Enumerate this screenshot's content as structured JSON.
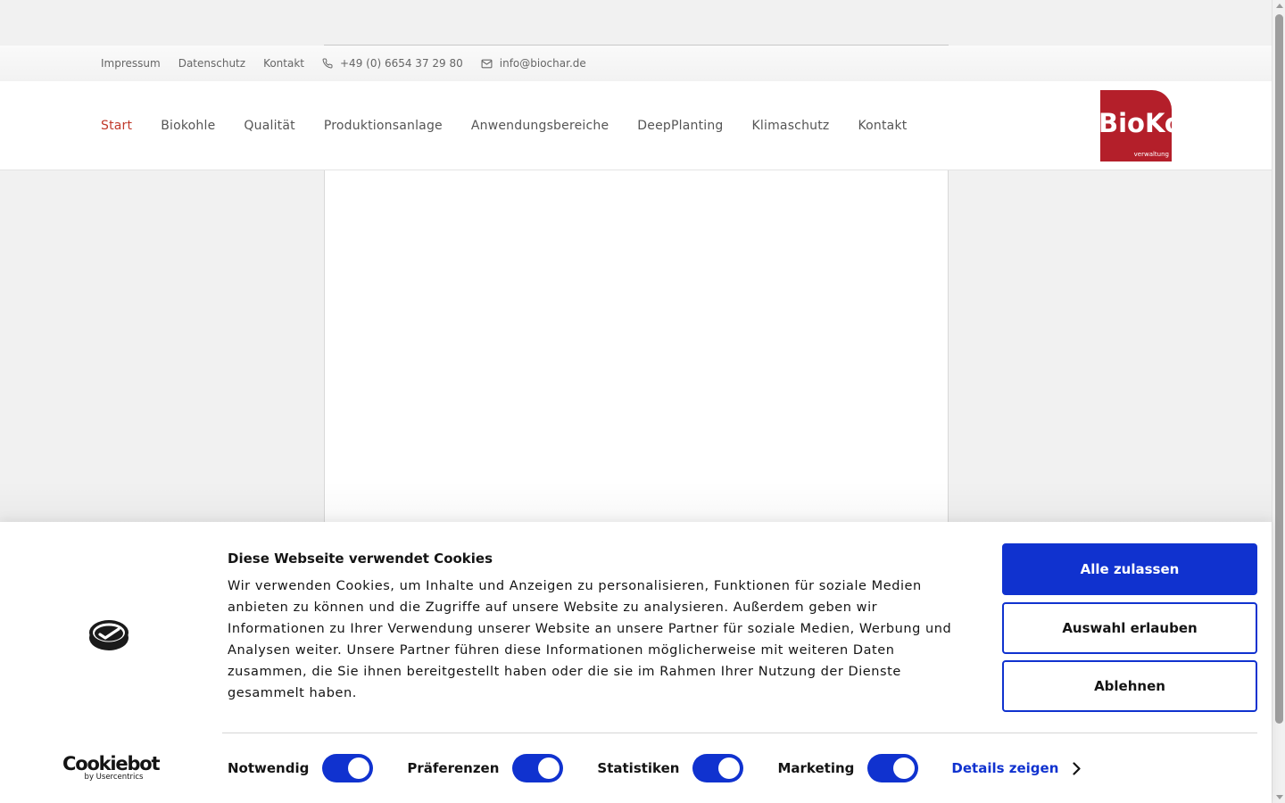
{
  "topbar": {
    "links": [
      "Impressum",
      "Datenschutz",
      "Kontakt"
    ],
    "phone": "+49 (0) 6654 37 29 80",
    "email": "info@biochar.de"
  },
  "nav": {
    "items": [
      {
        "label": "Start",
        "active": true
      },
      {
        "label": "Biokohle"
      },
      {
        "label": "Qualität"
      },
      {
        "label": "Produktionsanlage"
      },
      {
        "label": "Anwendungsbereiche"
      },
      {
        "label": "DeepPlanting"
      },
      {
        "label": "Klimaschutz"
      },
      {
        "label": "Kontakt"
      }
    ],
    "active_color": "#c0392b"
  },
  "logo": {
    "text": "BioKo",
    "subtext": "verwaltung",
    "color": "#b41f2a"
  },
  "cookie_banner": {
    "title": "Diese Webseite verwendet Cookies",
    "text": "Wir verwenden Cookies, um Inhalte und Anzeigen zu personalisieren, Funktionen für soziale Medien anbieten zu können und die Zugriffe auf unsere Website zu analysieren. Außerdem geben wir Informationen zu Ihrer Verwendung unserer Website an unsere Partner für soziale Medien, Werbung und Analysen weiter. Unsere Partner führen diese Informationen möglicherweise mit weiteren Daten zusammen, die Sie ihnen bereitgestellt haben oder die sie im Rahmen Ihrer Nutzung der Dienste gesammelt haben.",
    "buttons": {
      "allow_all": "Alle zulassen",
      "allow_selection": "Auswahl erlauben",
      "deny": "Ablehnen"
    },
    "toggles": [
      {
        "label": "Notwendig",
        "on": true
      },
      {
        "label": "Präferenzen",
        "on": true
      },
      {
        "label": "Statistiken",
        "on": true
      },
      {
        "label": "Marketing",
        "on": true
      }
    ],
    "details_label": "Details zeigen",
    "brand": {
      "name": "Cookiebot",
      "by": "by Usercentrics"
    },
    "accent_color": "#1032cf"
  }
}
